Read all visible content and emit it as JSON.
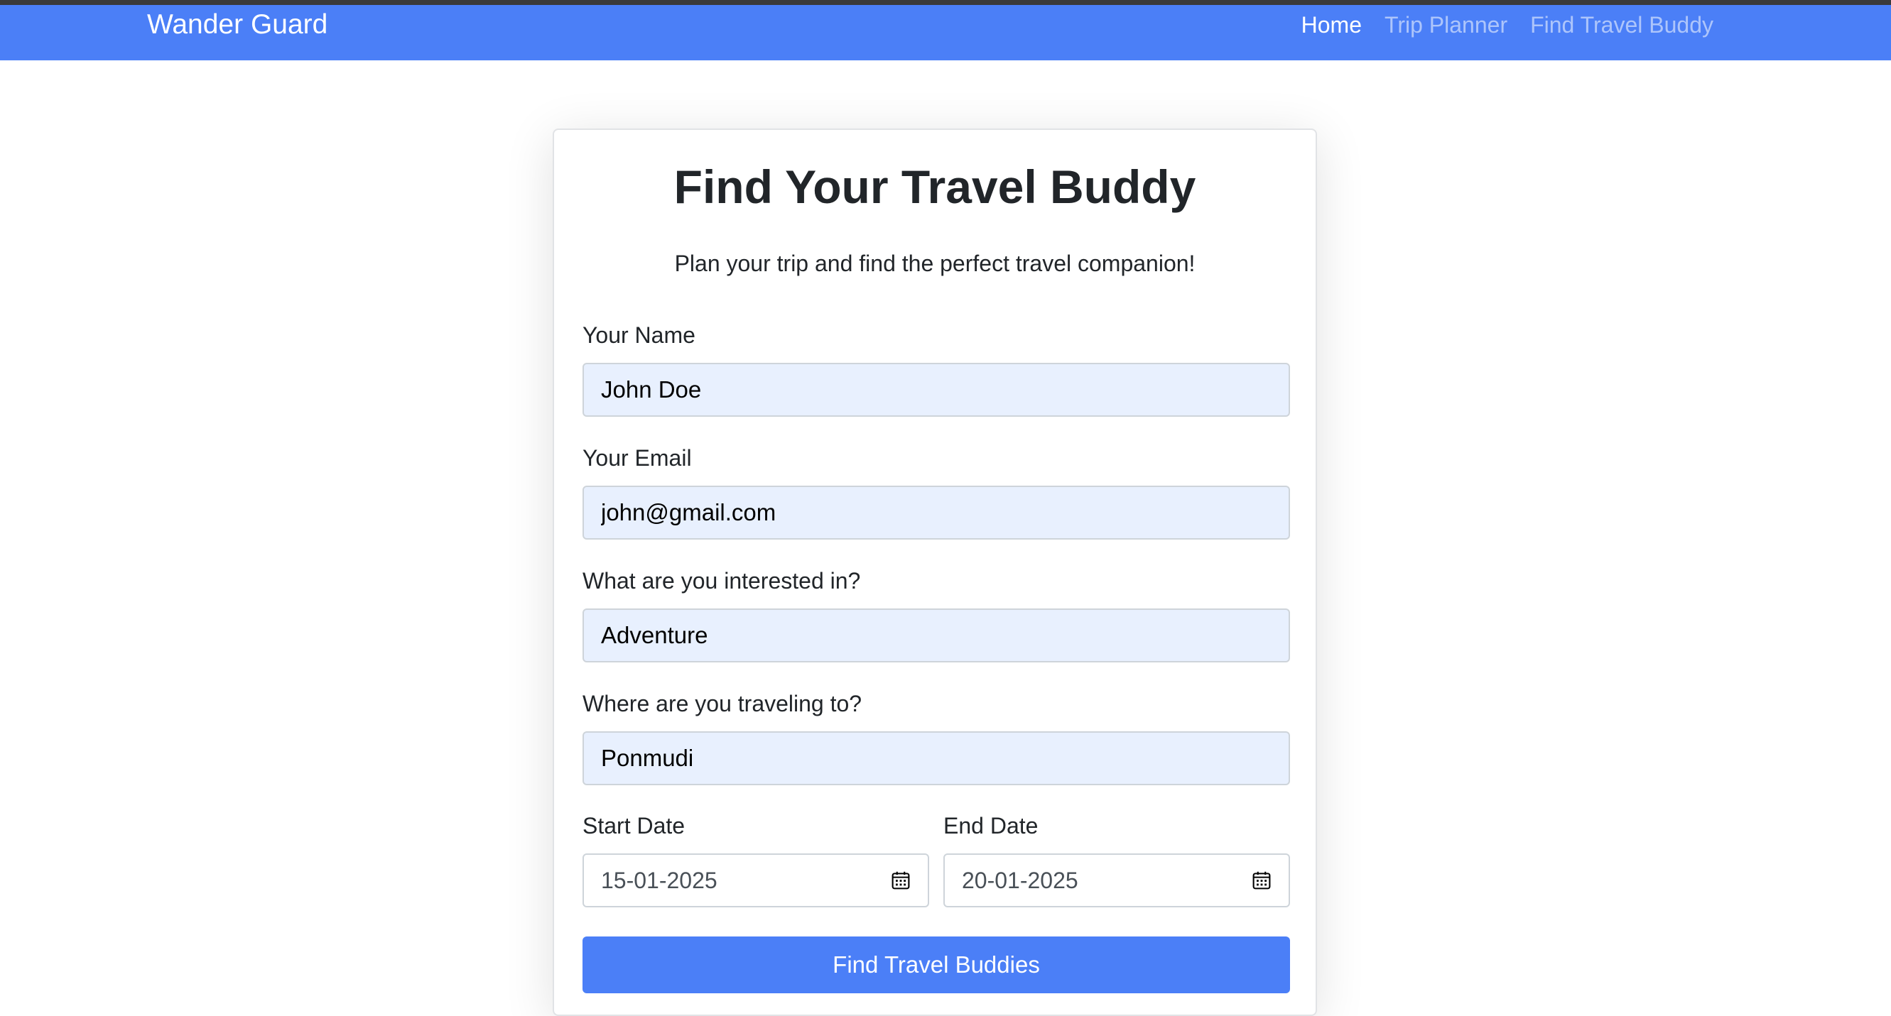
{
  "navbar": {
    "brand": "Wander Guard",
    "links": [
      {
        "label": "Home",
        "active": true
      },
      {
        "label": "Trip Planner",
        "active": false
      },
      {
        "label": "Find Travel Buddy",
        "active": false
      }
    ]
  },
  "form": {
    "title": "Find Your Travel Buddy",
    "subtitle": "Plan your trip and find the perfect travel companion!",
    "name": {
      "label": "Your Name",
      "value": "John Doe"
    },
    "email": {
      "label": "Your Email",
      "value": "john@gmail.com"
    },
    "interest": {
      "label": "What are you interested in?",
      "value": "Adventure"
    },
    "destination": {
      "label": "Where are you traveling to?",
      "value": "Ponmudi"
    },
    "start_date": {
      "label": "Start Date",
      "value": "15-01-2025",
      "icon": "calendar-icon"
    },
    "end_date": {
      "label": "End Date",
      "value": "20-01-2025",
      "icon": "calendar-icon"
    },
    "submit_label": "Find Travel Buddies"
  },
  "colors": {
    "navbar_bg": "#4b7ff7",
    "primary_button": "#4b7ff7",
    "autofill_input_bg": "#e8f0fe"
  }
}
